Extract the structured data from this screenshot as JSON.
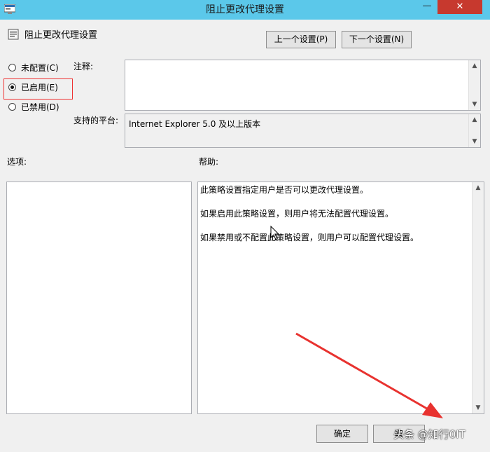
{
  "window": {
    "title": "阻止更改代理设置",
    "minimize_glyph": "—",
    "close_glyph": "✕"
  },
  "header": {
    "policy_name": "阻止更改代理设置",
    "prev_label": "上一个设置(P)",
    "next_label": "下一个设置(N)"
  },
  "radios": [
    {
      "label": "未配置(C)",
      "checked": false
    },
    {
      "label": "已启用(E)",
      "checked": true
    },
    {
      "label": "已禁用(D)",
      "checked": false
    }
  ],
  "comment": {
    "label": "注释:",
    "value": ""
  },
  "platform": {
    "label": "支持的平台:",
    "value": "Internet Explorer 5.0 及以上版本"
  },
  "options": {
    "label": "选项:"
  },
  "help": {
    "label": "帮助:",
    "lines": [
      "此策略设置指定用户是否可以更改代理设置。",
      "如果启用此策略设置，则用户将无法配置代理设置。",
      "如果禁用或不配置此策略设置，则用户可以配置代理设置。"
    ]
  },
  "footer": {
    "ok_label": "确定",
    "cancel_label": "取"
  },
  "watermark": "头条 @知行0IT",
  "colors": {
    "titlebar": "#5bc8ea",
    "close": "#c7392e",
    "highlight": "#e33333",
    "annotation_arrow": "#e8322f"
  },
  "icons": [
    "window-icon",
    "policy-icon",
    "mouse-cursor-icon",
    "annotation-arrow-icon"
  ]
}
